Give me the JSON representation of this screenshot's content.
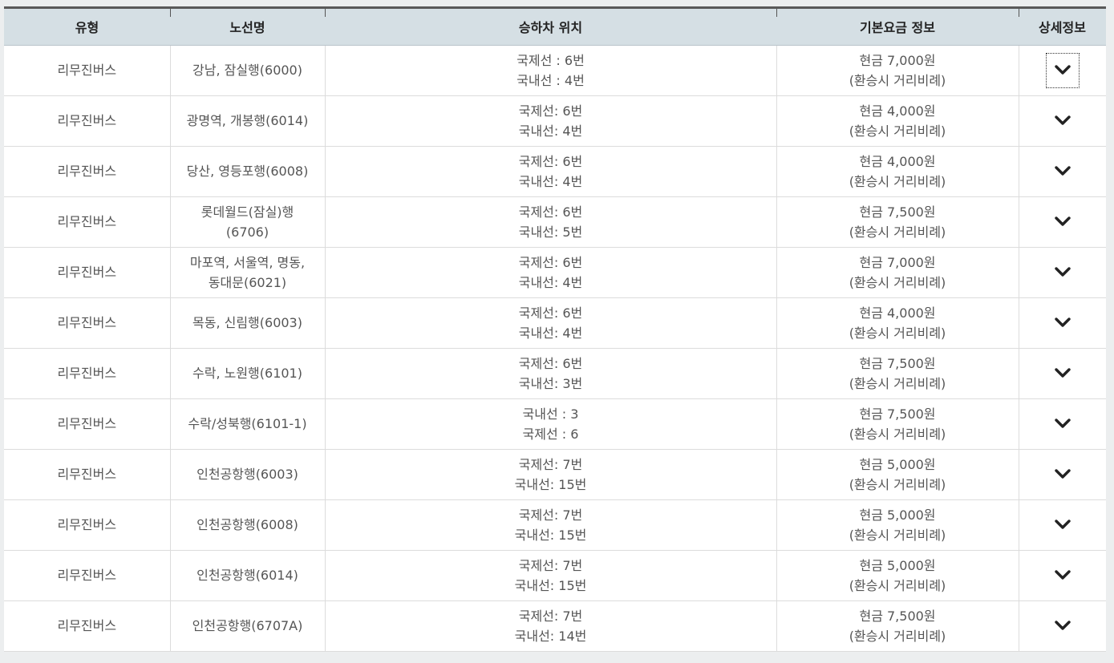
{
  "table": {
    "headers": {
      "type": "유형",
      "route": "노선명",
      "stop": "승하차 위치",
      "fare": "기본요금 정보",
      "detail": "상세정보"
    },
    "rows": [
      {
        "type": "리무진버스",
        "route": [
          "강남, 잠실행(6000)"
        ],
        "stop": [
          "국제선 : 6번",
          "국내선 : 4번"
        ],
        "fare": [
          "현금 7,000원",
          "(환승시 거리비례)"
        ]
      },
      {
        "type": "리무진버스",
        "route": [
          "광명역, 개봉행(6014)"
        ],
        "stop": [
          "국제선: 6번",
          "국내선: 4번"
        ],
        "fare": [
          "현금 4,000원",
          "(환승시 거리비례)"
        ]
      },
      {
        "type": "리무진버스",
        "route": [
          "당산, 영등포행(6008)"
        ],
        "stop": [
          "국제선: 6번",
          "국내선: 4번"
        ],
        "fare": [
          "현금 4,000원",
          "(환승시 거리비례)"
        ]
      },
      {
        "type": "리무진버스",
        "route": [
          "롯데월드(잠실)행",
          "(6706)"
        ],
        "stop": [
          "국제선: 6번",
          "국내선: 5번"
        ],
        "fare": [
          "현금 7,500원",
          "(환승시 거리비례)"
        ]
      },
      {
        "type": "리무진버스",
        "route": [
          "마포역, 서울역, 명동,",
          "동대문(6021)"
        ],
        "stop": [
          "국제선: 6번",
          "국내선: 4번"
        ],
        "fare": [
          "현금 7,000원",
          "(환승시 거리비례)"
        ]
      },
      {
        "type": "리무진버스",
        "route": [
          "목동, 신림행(6003)"
        ],
        "stop": [
          "국제선: 6번",
          "국내선: 4번"
        ],
        "fare": [
          "현금 4,000원",
          "(환승시 거리비례)"
        ]
      },
      {
        "type": "리무진버스",
        "route": [
          "수락, 노원행(6101)"
        ],
        "stop": [
          "국제선: 6번",
          "국내선: 3번"
        ],
        "fare": [
          "현금 7,500원",
          "(환승시 거리비례)"
        ]
      },
      {
        "type": "리무진버스",
        "route": [
          "수락/성북행(6101-1)"
        ],
        "stop": [
          "국내선 : 3",
          "국제선 : 6"
        ],
        "fare": [
          "현금 7,500원",
          "(환승시 거리비례)"
        ]
      },
      {
        "type": "리무진버스",
        "route": [
          "인천공항행(6003)"
        ],
        "stop": [
          "국제선: 7번",
          "국내선: 15번"
        ],
        "fare": [
          "현금 5,000원",
          "(환승시 거리비례)"
        ]
      },
      {
        "type": "리무진버스",
        "route": [
          "인천공항행(6008)"
        ],
        "stop": [
          "국제선: 7번",
          "국내선: 15번"
        ],
        "fare": [
          "현금 5,000원",
          "(환승시 거리비례)"
        ]
      },
      {
        "type": "리무진버스",
        "route": [
          "인천공항행(6014)"
        ],
        "stop": [
          "국제선: 7번",
          "국내선: 15번"
        ],
        "fare": [
          "현금 5,000원",
          "(환승시 거리비례)"
        ]
      },
      {
        "type": "리무진버스",
        "route": [
          "인천공항행(6707A)"
        ],
        "stop": [
          "국제선: 7번",
          "국내선: 14번"
        ],
        "fare": [
          "현금 7,500원",
          "(환승시 거리비례)"
        ]
      }
    ],
    "detail_icon": "chevron-down-icon",
    "focused_row": 0
  }
}
